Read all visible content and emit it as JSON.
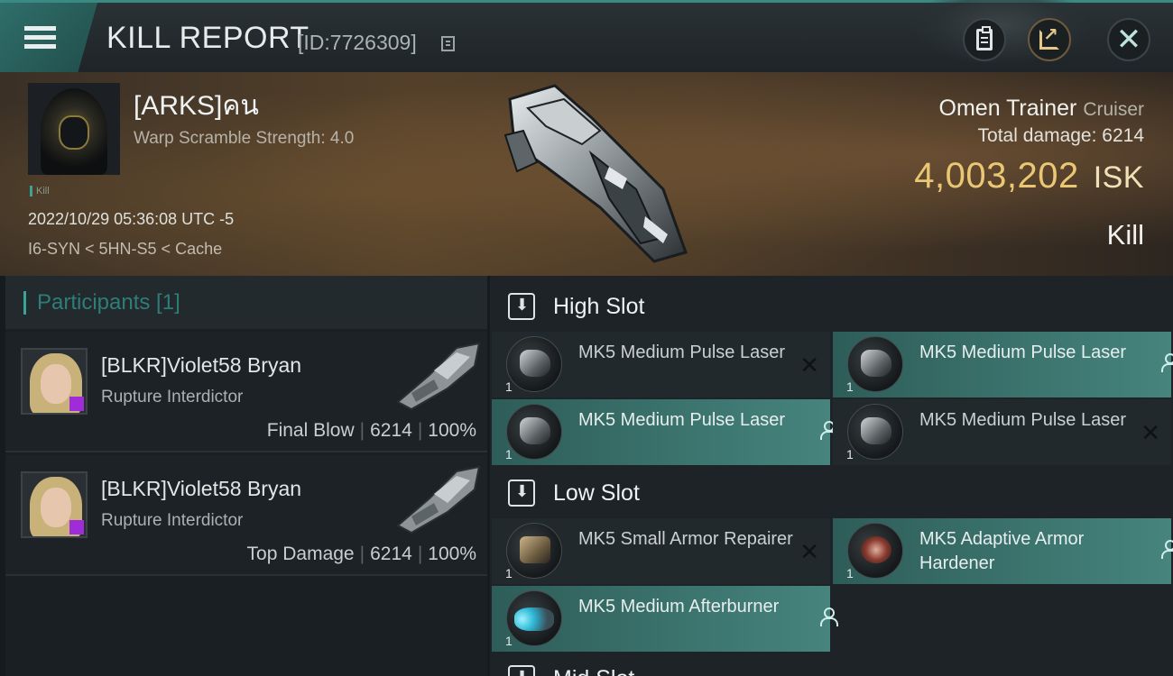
{
  "header": {
    "title": "KILL REPORT",
    "report_id": "[ID:7726309]"
  },
  "victim": {
    "name": "[ARKS]คน",
    "scramble": "Warp Scramble Strength: 4.0",
    "tag": "Kill",
    "date": "2022/10/29 05:36:08 UTC -5",
    "location": "I6-SYN < 5HN-S5 < Cache",
    "ship_name": "Omen Trainer",
    "ship_class": "Cruiser",
    "total_damage": "Total damage: 6214",
    "isk_value": "4,003,202",
    "isk_unit": "ISK",
    "result": "Kill"
  },
  "participants": {
    "title": "Participants [1]",
    "items": [
      {
        "name": "[BLKR]Violet58 Bryan",
        "ship": "Rupture Interdictor",
        "role": "Final Blow",
        "damage": "6214",
        "percent": "100%"
      },
      {
        "name": "[BLKR]Violet58 Bryan",
        "ship": "Rupture Interdictor",
        "role": "Top Damage",
        "damage": "6214",
        "percent": "100%"
      }
    ]
  },
  "fitting": {
    "high_slot": "High Slot",
    "low_slot": "Low Slot",
    "mid_slot": "Mid Slot",
    "modules": [
      {
        "name": "MK5 Medium Pulse Laser",
        "qty": "1",
        "status": "destroyed",
        "icon": "laser-icon"
      },
      {
        "name": "MK5 Medium Pulse Laser",
        "qty": "1",
        "status": "dropped",
        "icon": "laser-icon"
      },
      {
        "name": "MK5 Medium Pulse Laser",
        "qty": "1",
        "status": "dropped",
        "icon": "laser-icon"
      },
      {
        "name": "MK5 Medium Pulse Laser",
        "qty": "1",
        "status": "destroyed",
        "icon": "laser-icon"
      },
      {
        "name": "MK5 Small Armor Repairer",
        "qty": "1",
        "status": "destroyed",
        "icon": "armor-repairer-icon"
      },
      {
        "name": "MK5 Adaptive Armor Hardener",
        "qty": "1",
        "status": "dropped",
        "icon": "armor-hardener-icon"
      },
      {
        "name": "MK5 Medium Afterburner",
        "qty": "1",
        "status": "dropped",
        "icon": "afterburner-icon"
      }
    ]
  },
  "colors": {
    "accent": "#3aa396",
    "isk": "#e9c773",
    "fitted_bg": "#46847d"
  }
}
